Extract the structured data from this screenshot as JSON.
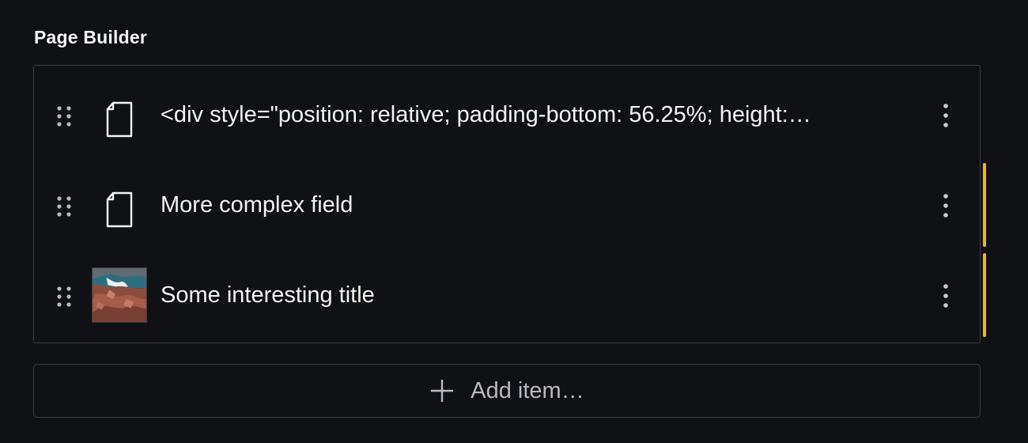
{
  "field": {
    "label": "Page Builder"
  },
  "items": [
    {
      "icon": "document-icon",
      "title": "<div style=\"position: relative; padding-bottom: 56.25%; height:…"
    },
    {
      "icon": "document-icon",
      "title": "More complex field",
      "changed": true
    },
    {
      "icon": "image-thumbnail",
      "title": "Some interesting title",
      "changed": true
    }
  ],
  "add_button": {
    "label": "Add item…",
    "icon": "plus-icon"
  },
  "colors": {
    "background": "#101114",
    "border": "#3a3c42",
    "text": "#f2f3f5",
    "muted_text": "#b8bac2",
    "changed_indicator": "#e6b62e"
  }
}
